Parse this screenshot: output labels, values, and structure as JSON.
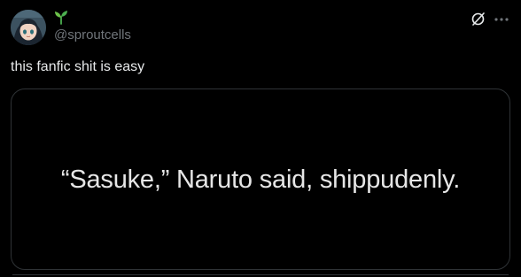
{
  "author": {
    "handle": "@sproutcells",
    "display_name_icon": "seedling-icon",
    "avatar": "avatar-image"
  },
  "header_actions": {
    "grok_icon": "grok-icon",
    "more_icon": "more-icon"
  },
  "tweet": {
    "text": "this fanfic shit is easy"
  },
  "media": {
    "text": "“Sasuke,” Naruto said, shippudenly."
  },
  "colors": {
    "background": "#000000",
    "text": "#e7e9ea",
    "secondary_text": "#71767b",
    "border": "#2f3336",
    "seedling": "#4caf50"
  }
}
